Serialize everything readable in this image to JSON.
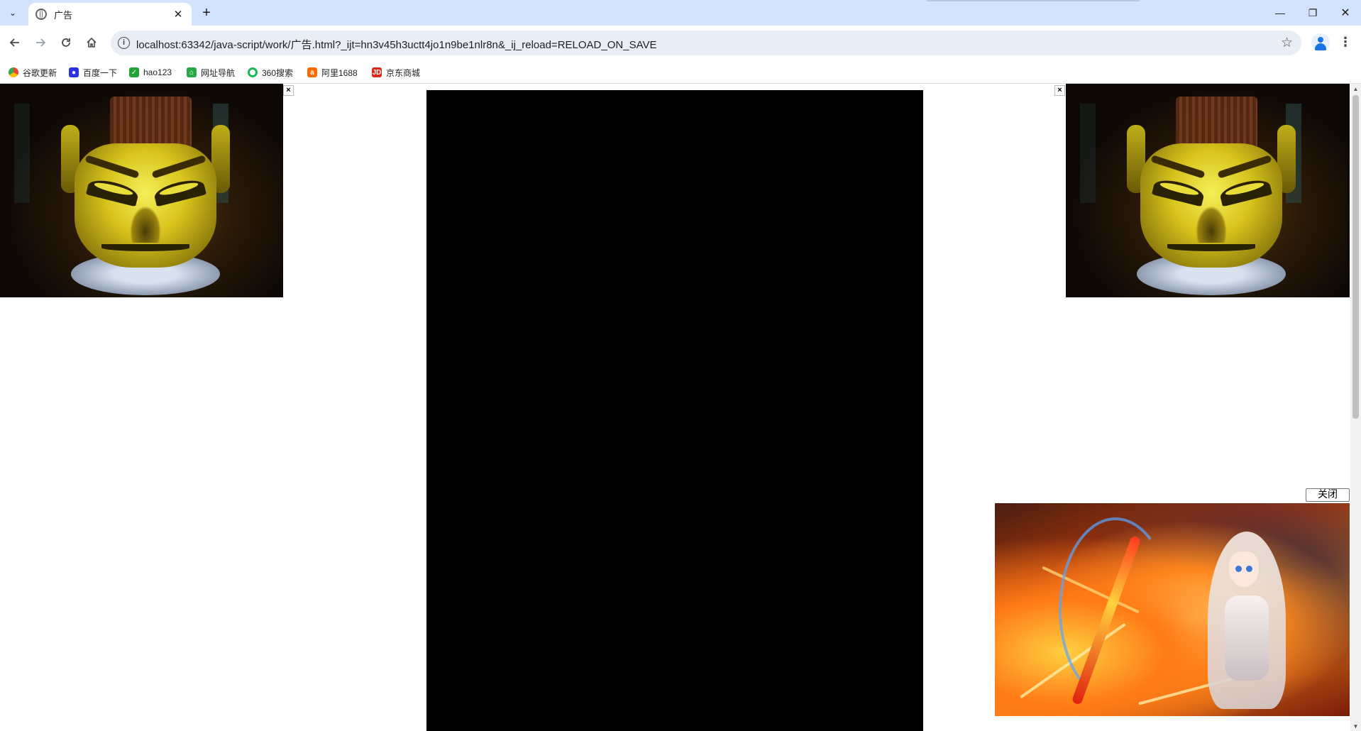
{
  "browser": {
    "tab_title": "广告",
    "tab_close": "✕",
    "new_tab": "+",
    "url": "localhost:63342/java-script/work/广告.html?_ijt=hn3v45h3uctt4jo1n9be1nlr8n&_ij_reload=RELOAD_ON_SAVE",
    "window_controls": {
      "minimize": "—",
      "maximize": "❐",
      "close": "✕"
    },
    "nav_icons": {
      "back": "back-arrow-icon",
      "forward": "forward-arrow-icon",
      "reload": "reload-icon",
      "home": "home-icon"
    }
  },
  "bookmarks": [
    {
      "label": "谷歌更新",
      "icon": "chrome-icon",
      "color": "#ea4335"
    },
    {
      "label": "百度一下",
      "icon": "baidu-icon",
      "color": "#2932e1"
    },
    {
      "label": "hao123",
      "icon": "hao123-icon",
      "color": "#22a33a"
    },
    {
      "label": "网址导航",
      "icon": "nav-site-icon",
      "color": "#28a745"
    },
    {
      "label": "360搜索",
      "icon": "360-icon",
      "color": "#19b955"
    },
    {
      "label": "阿里1688",
      "icon": "ali1688-icon",
      "color": "#ff6a00"
    },
    {
      "label": "京东商城",
      "icon": "jd-icon",
      "color": "#e1251b"
    }
  ],
  "page": {
    "left_ad_close": "×",
    "right_ad_close": "×",
    "popup_close_label": "关闭",
    "left_ad_image": "bronze-mask-image",
    "right_ad_image": "bronze-mask-image",
    "popup_ad_image": "anime-warrior-image"
  }
}
